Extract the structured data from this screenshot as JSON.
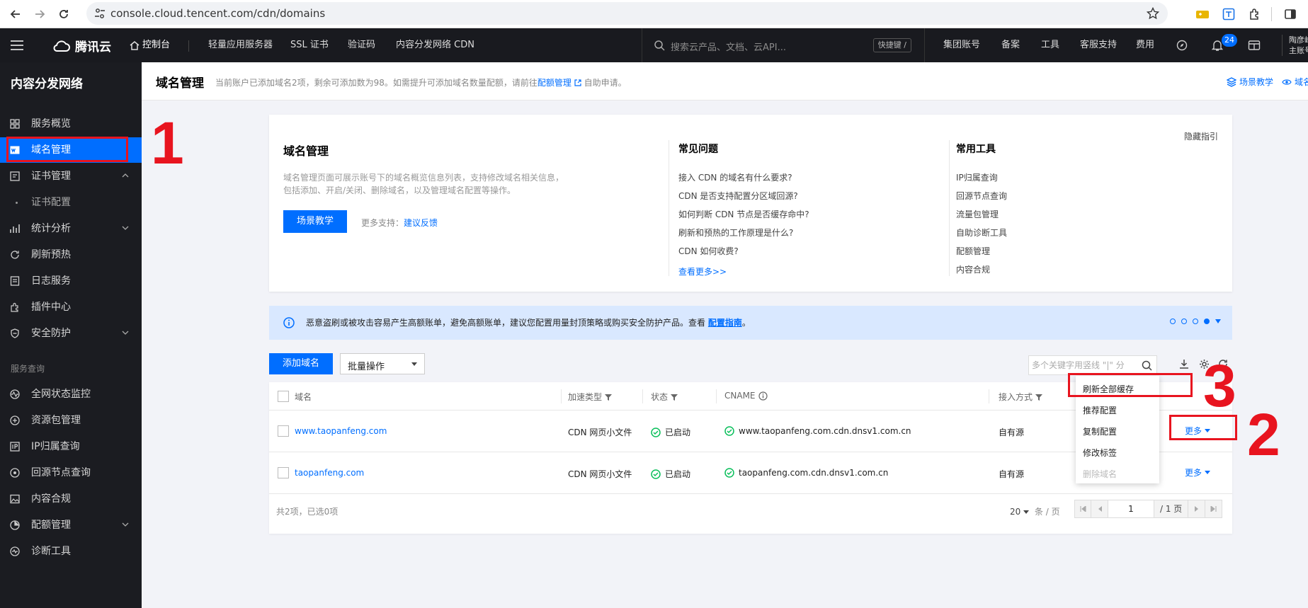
{
  "browser": {
    "url": "console.cloud.tencent.com/cdn/domains"
  },
  "topnav": {
    "brand": "腾讯云",
    "console": "控制台",
    "links": [
      "轻量应用服务器",
      "SSL 证书",
      "验证码",
      "内容分发网络 CDN"
    ],
    "search_placeholder": "搜索云产品、文档、云API...",
    "shortcut": "快捷键 /",
    "right_links": [
      "集团账号",
      "备案",
      "工具",
      "客服支持",
      "费用"
    ],
    "notification_count": "24",
    "user_line1": "陶彦峰",
    "user_line2": "主账号"
  },
  "sidebar": {
    "title": "内容分发网络",
    "items": [
      {
        "label": "服务概览",
        "icon": "grid-icon"
      },
      {
        "label": "域名管理",
        "icon": "domain-icon",
        "active": true
      },
      {
        "label": "证书管理",
        "icon": "certificate-icon",
        "expanded": true
      },
      {
        "label": "证书配置",
        "sub": true
      },
      {
        "label": "统计分析",
        "icon": "chart-icon",
        "collapsible": true
      },
      {
        "label": "刷新预热",
        "icon": "refresh-icon"
      },
      {
        "label": "日志服务",
        "icon": "log-icon"
      },
      {
        "label": "插件中心",
        "icon": "plugin-icon"
      },
      {
        "label": "安全防护",
        "icon": "shield-icon",
        "collapsible": true
      }
    ],
    "section_label": "服务查询",
    "items2": [
      {
        "label": "全网状态监控",
        "icon": "monitor-icon"
      },
      {
        "label": "资源包管理",
        "icon": "package-icon"
      },
      {
        "label": "IP归属查询",
        "icon": "ip-icon"
      },
      {
        "label": "回源节点查询",
        "icon": "origin-icon"
      },
      {
        "label": "内容合规",
        "icon": "image-icon"
      },
      {
        "label": "配额管理",
        "icon": "quota-icon",
        "collapsible": true
      },
      {
        "label": "诊断工具",
        "icon": "diagnose-icon"
      }
    ]
  },
  "header": {
    "title": "域名管理",
    "desc_prefix": "当前账户已添加域名2项，剩余可添加数为98。如需提升可添加域名数量配额，请前往",
    "desc_link": "配额管理",
    "desc_suffix": "自助申请。",
    "scene": "场景教学",
    "domain_label": "域名"
  },
  "intro": {
    "title": "域名管理",
    "desc_line1": "域名管理页面可展示账号下的域名概览信息列表，支持修改域名相关信息，",
    "desc_line2": "包括添加、开启/关闭、删除域名，以及管理域名配置等操作。",
    "scene_button": "场景教学",
    "more_support": "更多支持：",
    "feedback": "建议反馈",
    "faq_title": "常见问题",
    "faq": [
      "接入 CDN 的域名有什么要求?",
      "CDN 是否支持配置分区域回源?",
      "如何判断 CDN 节点是否缓存命中?",
      "刷新和预热的工作原理是什么?",
      "CDN 如何收费?"
    ],
    "faq_more": "查看更多>>",
    "tools_title": "常用工具",
    "tools": [
      "IP归属查询",
      "回源节点查询",
      "流量包管理",
      "自助诊断工具",
      "配额管理",
      "内容合规"
    ],
    "hide_guide": "隐藏指引"
  },
  "notice": {
    "text": "恶意盗刷或被攻击容易产生高额账单，避免高额账单，建议您配置用量封顶策略或购买安全防护产品。查看",
    "link": "配置指南",
    "end": "。"
  },
  "toolbar": {
    "add_domain": "添加域名",
    "batch": "批量操作",
    "search_placeholder": "多个关键字用竖线 \"|\" 分"
  },
  "table": {
    "headers": [
      "域名",
      "加速类型",
      "状态",
      "CNAME",
      "接入方式"
    ],
    "rows": [
      {
        "domain": "www.taopanfeng.com",
        "type": "CDN 网页小文件",
        "status": "已启动",
        "cname": "www.taopanfeng.com.cdn.dnsv1.com.cn",
        "access": "自有源",
        "more": "更多"
      },
      {
        "domain": "taopanfeng.com",
        "type": "CDN 网页小文件",
        "status": "已启动",
        "cname": "taopanfeng.com.cdn.dnsv1.com.cn",
        "access": "自有源",
        "more": "更多"
      }
    ],
    "footer": "共2项，已选0项",
    "page_size": "20",
    "per_page": "条 / 页",
    "page": "1",
    "total_pages": "/ 1 页"
  },
  "menu": {
    "items": [
      "刷新全部缓存",
      "推荐配置",
      "复制配置",
      "修改标签",
      "删除域名"
    ]
  },
  "annotations": {
    "a1": "1",
    "a2": "2",
    "a3": "3"
  },
  "colors": {
    "accent": "#006eff",
    "annotation": "#e8141f",
    "success": "#0abf5b"
  }
}
